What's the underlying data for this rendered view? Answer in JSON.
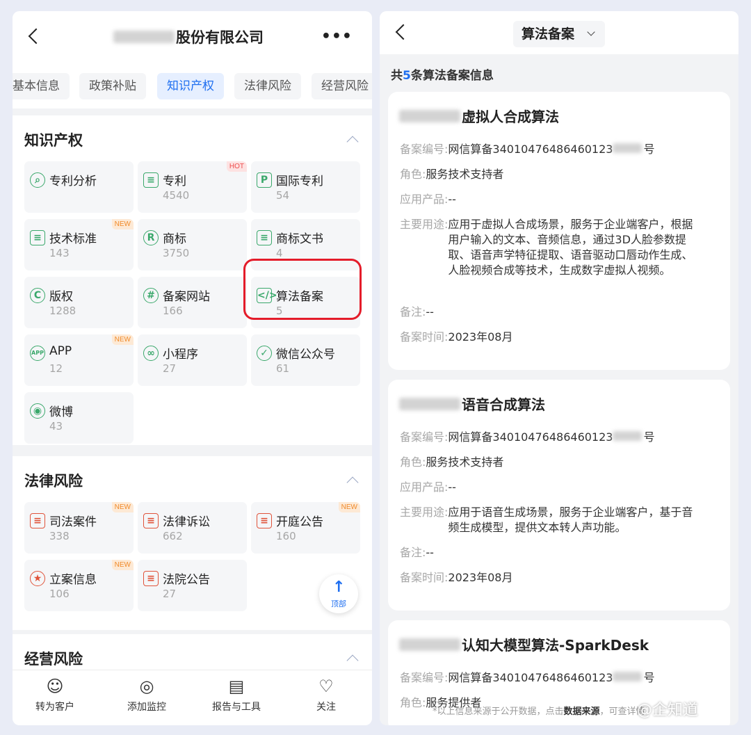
{
  "left": {
    "header": {
      "company_name": "股份有限公司"
    },
    "tabs": [
      "基本信息",
      "政策补贴",
      "知识产权",
      "法律风险",
      "经营风险"
    ],
    "active_tab": "知识产权",
    "ip_section": {
      "title": "知识产权",
      "items": [
        {
          "label": "专利分析",
          "count": "",
          "badge": ""
        },
        {
          "label": "专利",
          "count": "4540",
          "badge": "HOT"
        },
        {
          "label": "国际专利",
          "count": "54",
          "badge": ""
        },
        {
          "label": "技术标准",
          "count": "143",
          "badge": "NEW"
        },
        {
          "label": "商标",
          "count": "3750",
          "badge": ""
        },
        {
          "label": "商标文书",
          "count": "4",
          "badge": ""
        },
        {
          "label": "版权",
          "count": "1288",
          "badge": ""
        },
        {
          "label": "备案网站",
          "count": "166",
          "badge": ""
        },
        {
          "label": "算法备案",
          "count": "5",
          "badge": ""
        },
        {
          "label": "APP",
          "count": "12",
          "badge": "NEW"
        },
        {
          "label": "小程序",
          "count": "27",
          "badge": ""
        },
        {
          "label": "微信公众号",
          "count": "61",
          "badge": ""
        },
        {
          "label": "微博",
          "count": "43",
          "badge": ""
        }
      ]
    },
    "legal_section": {
      "title": "法律风险",
      "items": [
        {
          "label": "司法案件",
          "count": "338",
          "badge": "NEW"
        },
        {
          "label": "法律诉讼",
          "count": "662",
          "badge": ""
        },
        {
          "label": "开庭公告",
          "count": "160",
          "badge": "NEW"
        },
        {
          "label": "立案信息",
          "count": "106",
          "badge": "NEW"
        },
        {
          "label": "法院公告",
          "count": "27",
          "badge": ""
        }
      ]
    },
    "business_section": {
      "title": "经营风险"
    },
    "top_button": "顶部",
    "bottom_nav": [
      "转为客户",
      "添加监控",
      "报告与工具",
      "关注"
    ]
  },
  "right": {
    "title": "算法备案",
    "summary": {
      "prefix": "共",
      "count": "5",
      "suffix": "条算法备案信息"
    },
    "records": [
      {
        "name": "虚拟人合成算法",
        "reg_label": "备案编号:",
        "reg_value": "网信算备34010476486460123",
        "reg_suffix": "号",
        "role_label": "角色:",
        "role_value": "服务技术支持者",
        "product_label": "应用产品:",
        "product_value": "--",
        "usage_label": "主要用途:",
        "usage_value": "应用于虚拟人合成场景，服务于企业端客户，根据用户输入的文本、音频信息，通过3D人脸参数提取、语音声学特征提取、语音驱动口唇动作生成、人脸视频合成等技术，生成数字虚拟人视频。",
        "note_label": "备注:",
        "note_value": "--",
        "time_label": "备案时间:",
        "time_value": "2023年08月"
      },
      {
        "name": "语音合成算法",
        "reg_label": "备案编号:",
        "reg_value": "网信算备34010476486460123",
        "reg_suffix": "号",
        "role_label": "角色:",
        "role_value": "服务技术支持者",
        "product_label": "应用产品:",
        "product_value": "--",
        "usage_label": "主要用途:",
        "usage_value": "应用于语音生成场景，服务于企业端客户，基于音频生成模型，提供文本转人声功能。",
        "note_label": "备注:",
        "note_value": "--",
        "time_label": "备案时间:",
        "time_value": "2023年08月"
      },
      {
        "name": "认知大模型算法-SparkDesk",
        "reg_label": "备案编号:",
        "reg_value": "网信算备34010476486460123",
        "reg_suffix": "号",
        "role_label": "角色:",
        "role_value": "服务提供者"
      }
    ],
    "footer_note": {
      "text": "*以上信息来源于公开数据，点击",
      "link": "数据来源",
      "tail": "，可查详情"
    }
  },
  "watermark": "@企知道"
}
